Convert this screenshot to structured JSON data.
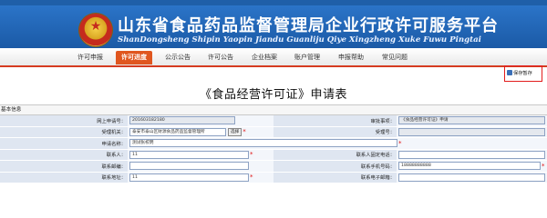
{
  "header": {
    "title": "山东省食品药品监督管理局企业行政许可服务平台",
    "subtitle": "ShanDongsheng Shipin Yaopin Jiandu Guanliju Qiye Xingzheng Xuke Fuwu Pingtai",
    "brand_color": "#1f5fa8"
  },
  "nav": {
    "items": [
      {
        "label": "许可申报"
      },
      {
        "label": "许可进度"
      },
      {
        "label": "公示公告"
      },
      {
        "label": "许可公告"
      },
      {
        "label": "企业档案"
      },
      {
        "label": "账户管理"
      },
      {
        "label": "申报帮助"
      },
      {
        "label": "常见问题"
      }
    ],
    "active_index": 1,
    "active_color": "#e0561f"
  },
  "toolbar": {
    "save_label": "保存暂存"
  },
  "form": {
    "title": "《食品经营许可证》申请表",
    "section_label": "基本信息",
    "fields": {
      "online_no": {
        "label": "网上申请号：",
        "value": "201603182180"
      },
      "matter": {
        "label": "审批事项：",
        "value": "《食品经营许可证》申请"
      },
      "agency": {
        "label": "受理机关：",
        "value": "泰安市泰山区财源食品药品监督管理所",
        "choose": "选择"
      },
      "accept_no": {
        "label": "受理号：",
        "value": ""
      },
      "applicant": {
        "label": "申请名称：",
        "value": "测试张校明"
      },
      "contact": {
        "label": "联系人：",
        "value": "11"
      },
      "phone": {
        "label": "联系人固定电话：",
        "value": ""
      },
      "zip": {
        "label": "联系邮编：",
        "value": ""
      },
      "mobile": {
        "label": "联系手机号码：",
        "value": "18888888888"
      },
      "address": {
        "label": "联系地址：",
        "value": "11"
      },
      "email": {
        "label": "联系电子邮箱：",
        "value": ""
      }
    }
  }
}
